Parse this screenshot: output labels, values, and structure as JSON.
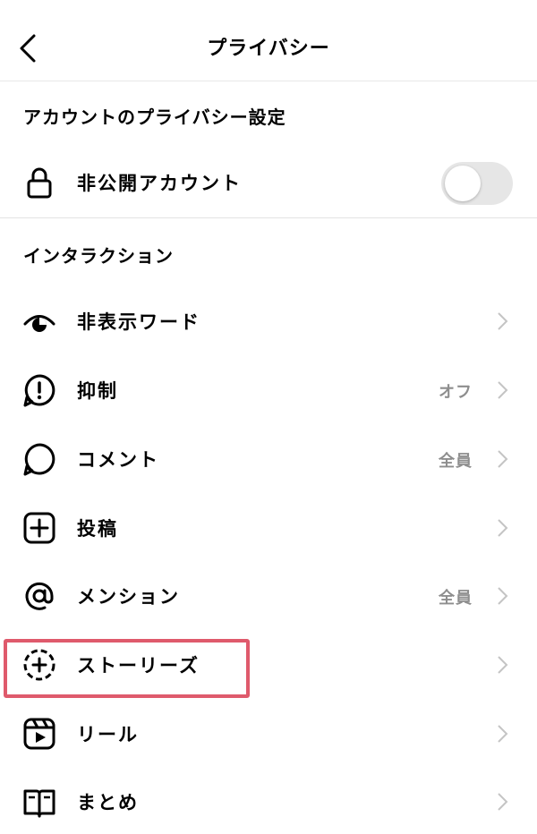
{
  "header": {
    "title": "プライバシー"
  },
  "account_section": {
    "title": "アカウントのプライバシー設定",
    "private_account": {
      "label": "非公開アカウント",
      "enabled": false
    }
  },
  "interaction_section": {
    "title": "インタラクション",
    "items": [
      {
        "label": "非表示ワード",
        "value": "",
        "icon": "eye-icon"
      },
      {
        "label": "抑制",
        "value": "オフ",
        "icon": "restrict-alert-icon"
      },
      {
        "label": "コメント",
        "value": "全員",
        "icon": "comment-bubble-icon"
      },
      {
        "label": "投稿",
        "value": "",
        "icon": "plus-square-icon"
      },
      {
        "label": "メンション",
        "value": "全員",
        "icon": "at-sign-icon"
      },
      {
        "label": "ストーリーズ",
        "value": "",
        "icon": "story-plus-icon"
      },
      {
        "label": "リール",
        "value": "",
        "icon": "reels-icon"
      },
      {
        "label": "まとめ",
        "value": "",
        "icon": "guide-book-icon"
      }
    ]
  },
  "highlight": {
    "target": "ストーリーズ",
    "color": "#df5a6c"
  }
}
